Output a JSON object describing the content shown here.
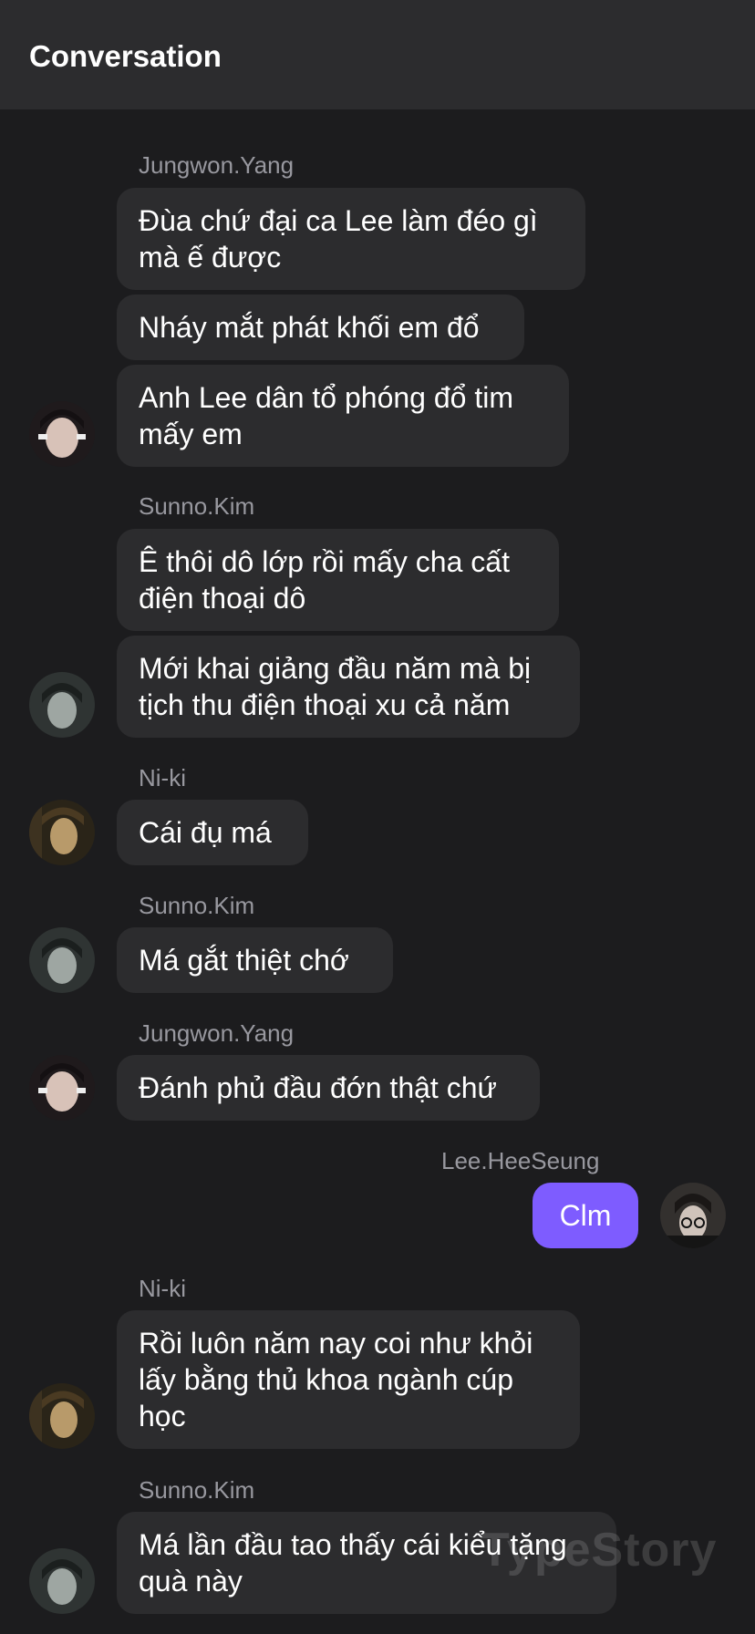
{
  "header": {
    "title": "Conversation"
  },
  "messages": [
    {
      "name": "Jungwon.Yang",
      "texts": [
        "Đùa chứ đại ca Lee làm đéo gì mà ế được",
        "Nháy mắt phát khối em đổ",
        "Anh Lee dân tổ phóng đổ tim mấy em"
      ]
    },
    {
      "name": "Sunno.Kim",
      "texts": [
        "Ê thôi dô lớp rồi mấy cha cất điện thoại dô",
        "Mới khai giảng đầu năm mà bị tịch thu điện thoại xu cả năm"
      ]
    },
    {
      "name": "Ni-ki",
      "texts": [
        "Cái đụ má"
      ]
    },
    {
      "name": "Sunno.Kim",
      "texts": [
        "Má gắt thiệt chớ"
      ]
    },
    {
      "name": "Jungwon.Yang",
      "texts": [
        "Đánh phủ đầu đớn thật chứ"
      ]
    },
    {
      "name": "Lee.HeeSeung",
      "texts": [
        "Clm"
      ]
    },
    {
      "name": "Ni-ki",
      "texts": [
        "Rồi luôn năm nay coi như khỏi lấy bằng thủ khoa ngành cúp học"
      ]
    },
    {
      "name": "Sunno.Kim",
      "texts": [
        "Má lần đầu tao thấy cái kiểu tặng quà này"
      ]
    }
  ],
  "watermark": "TypeStory",
  "icons": {
    "avatar": "avatar-icon"
  },
  "colors": {
    "own_bubble": "#7e5cff",
    "bubble": "#2c2c2e",
    "background": "#1c1c1e",
    "header": "#2c2c2e"
  }
}
